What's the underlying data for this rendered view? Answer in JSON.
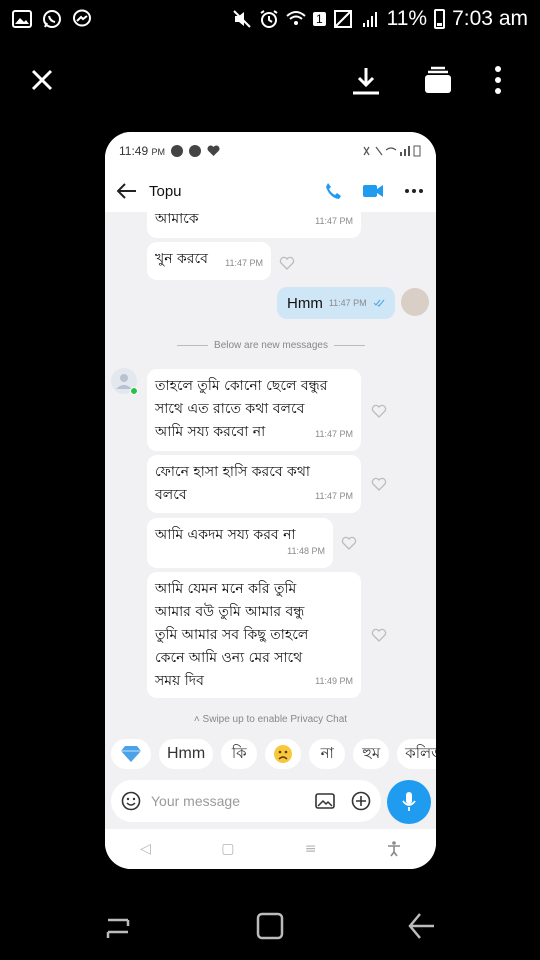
{
  "status": {
    "battery": "11%",
    "time": "7:03 am",
    "sim": "1"
  },
  "phone": {
    "status": {
      "time": "11:49",
      "ampm": "PM"
    },
    "contact_name": "Topu",
    "messages": [
      {
        "text": "আমাকে",
        "time": "11:47 PM"
      },
      {
        "text": "খুন করবে",
        "time": "11:47 PM"
      },
      {
        "text": "Hmm",
        "time": "11:47 PM"
      },
      {
        "text": "তাহলে তুমি কোনো ছেলে বন্ধুর\nসাথে এত রাতে কথা বলবে\nআমি সয্য করবো না",
        "time": "11:47 PM"
      },
      {
        "text": "ফোনে হাসা হাসি করবে কথা\nবলবে",
        "time": "11:47 PM"
      },
      {
        "text": "আমি একদম সয্য করব না",
        "time": "11:48 PM"
      },
      {
        "text": "আমি যেমন মনে করি তুমি\nআমার বউ তুমি আমার বন্ধু\nতুমি আমার সব কিছু তাহলে\nকেনে আমি ওন্য মের সাথে\nসময় দিব",
        "time": "11:49 PM"
      }
    ],
    "divider": "Below are new messages",
    "privacy": "Swipe up to enable Privacy Chat",
    "chips": [
      "Hmm",
      "কি",
      "না",
      "হুম",
      "কলিজা"
    ],
    "composer_placeholder": "Your message"
  }
}
